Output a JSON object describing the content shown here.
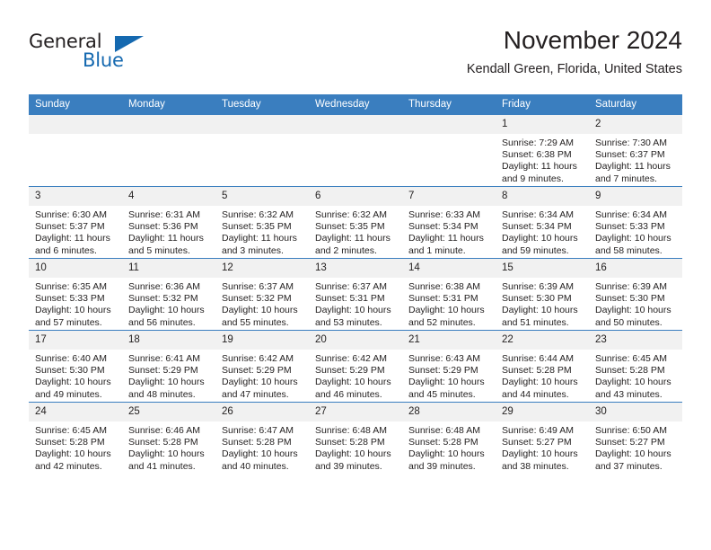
{
  "brand": {
    "name_part1": "General",
    "name_part2": "Blue",
    "accent_color": "#1569b0"
  },
  "header": {
    "title": "November 2024",
    "subtitle": "Kendall Green, Florida, United States"
  },
  "theme": {
    "header_row_bg": "#3a7ebf",
    "daynum_bg": "#f1f1f1",
    "text": "#221f1f"
  },
  "weekdays": [
    "Sunday",
    "Monday",
    "Tuesday",
    "Wednesday",
    "Thursday",
    "Friday",
    "Saturday"
  ],
  "weeks": [
    [
      {
        "day": "",
        "blank": true,
        "sunrise": "",
        "sunset": "",
        "daylight": ""
      },
      {
        "day": "",
        "blank": true,
        "sunrise": "",
        "sunset": "",
        "daylight": ""
      },
      {
        "day": "",
        "blank": true,
        "sunrise": "",
        "sunset": "",
        "daylight": ""
      },
      {
        "day": "",
        "blank": true,
        "sunrise": "",
        "sunset": "",
        "daylight": ""
      },
      {
        "day": "",
        "blank": true,
        "sunrise": "",
        "sunset": "",
        "daylight": ""
      },
      {
        "day": "1",
        "blank": false,
        "sunrise": "Sunrise: 7:29 AM",
        "sunset": "Sunset: 6:38 PM",
        "daylight": "Daylight: 11 hours and 9 minutes."
      },
      {
        "day": "2",
        "blank": false,
        "sunrise": "Sunrise: 7:30 AM",
        "sunset": "Sunset: 6:37 PM",
        "daylight": "Daylight: 11 hours and 7 minutes."
      }
    ],
    [
      {
        "day": "3",
        "blank": false,
        "sunrise": "Sunrise: 6:30 AM",
        "sunset": "Sunset: 5:37 PM",
        "daylight": "Daylight: 11 hours and 6 minutes."
      },
      {
        "day": "4",
        "blank": false,
        "sunrise": "Sunrise: 6:31 AM",
        "sunset": "Sunset: 5:36 PM",
        "daylight": "Daylight: 11 hours and 5 minutes."
      },
      {
        "day": "5",
        "blank": false,
        "sunrise": "Sunrise: 6:32 AM",
        "sunset": "Sunset: 5:35 PM",
        "daylight": "Daylight: 11 hours and 3 minutes."
      },
      {
        "day": "6",
        "blank": false,
        "sunrise": "Sunrise: 6:32 AM",
        "sunset": "Sunset: 5:35 PM",
        "daylight": "Daylight: 11 hours and 2 minutes."
      },
      {
        "day": "7",
        "blank": false,
        "sunrise": "Sunrise: 6:33 AM",
        "sunset": "Sunset: 5:34 PM",
        "daylight": "Daylight: 11 hours and 1 minute."
      },
      {
        "day": "8",
        "blank": false,
        "sunrise": "Sunrise: 6:34 AM",
        "sunset": "Sunset: 5:34 PM",
        "daylight": "Daylight: 10 hours and 59 minutes."
      },
      {
        "day": "9",
        "blank": false,
        "sunrise": "Sunrise: 6:34 AM",
        "sunset": "Sunset: 5:33 PM",
        "daylight": "Daylight: 10 hours and 58 minutes."
      }
    ],
    [
      {
        "day": "10",
        "blank": false,
        "sunrise": "Sunrise: 6:35 AM",
        "sunset": "Sunset: 5:33 PM",
        "daylight": "Daylight: 10 hours and 57 minutes."
      },
      {
        "day": "11",
        "blank": false,
        "sunrise": "Sunrise: 6:36 AM",
        "sunset": "Sunset: 5:32 PM",
        "daylight": "Daylight: 10 hours and 56 minutes."
      },
      {
        "day": "12",
        "blank": false,
        "sunrise": "Sunrise: 6:37 AM",
        "sunset": "Sunset: 5:32 PM",
        "daylight": "Daylight: 10 hours and 55 minutes."
      },
      {
        "day": "13",
        "blank": false,
        "sunrise": "Sunrise: 6:37 AM",
        "sunset": "Sunset: 5:31 PM",
        "daylight": "Daylight: 10 hours and 53 minutes."
      },
      {
        "day": "14",
        "blank": false,
        "sunrise": "Sunrise: 6:38 AM",
        "sunset": "Sunset: 5:31 PM",
        "daylight": "Daylight: 10 hours and 52 minutes."
      },
      {
        "day": "15",
        "blank": false,
        "sunrise": "Sunrise: 6:39 AM",
        "sunset": "Sunset: 5:30 PM",
        "daylight": "Daylight: 10 hours and 51 minutes."
      },
      {
        "day": "16",
        "blank": false,
        "sunrise": "Sunrise: 6:39 AM",
        "sunset": "Sunset: 5:30 PM",
        "daylight": "Daylight: 10 hours and 50 minutes."
      }
    ],
    [
      {
        "day": "17",
        "blank": false,
        "sunrise": "Sunrise: 6:40 AM",
        "sunset": "Sunset: 5:30 PM",
        "daylight": "Daylight: 10 hours and 49 minutes."
      },
      {
        "day": "18",
        "blank": false,
        "sunrise": "Sunrise: 6:41 AM",
        "sunset": "Sunset: 5:29 PM",
        "daylight": "Daylight: 10 hours and 48 minutes."
      },
      {
        "day": "19",
        "blank": false,
        "sunrise": "Sunrise: 6:42 AM",
        "sunset": "Sunset: 5:29 PM",
        "daylight": "Daylight: 10 hours and 47 minutes."
      },
      {
        "day": "20",
        "blank": false,
        "sunrise": "Sunrise: 6:42 AM",
        "sunset": "Sunset: 5:29 PM",
        "daylight": "Daylight: 10 hours and 46 minutes."
      },
      {
        "day": "21",
        "blank": false,
        "sunrise": "Sunrise: 6:43 AM",
        "sunset": "Sunset: 5:29 PM",
        "daylight": "Daylight: 10 hours and 45 minutes."
      },
      {
        "day": "22",
        "blank": false,
        "sunrise": "Sunrise: 6:44 AM",
        "sunset": "Sunset: 5:28 PM",
        "daylight": "Daylight: 10 hours and 44 minutes."
      },
      {
        "day": "23",
        "blank": false,
        "sunrise": "Sunrise: 6:45 AM",
        "sunset": "Sunset: 5:28 PM",
        "daylight": "Daylight: 10 hours and 43 minutes."
      }
    ],
    [
      {
        "day": "24",
        "blank": false,
        "sunrise": "Sunrise: 6:45 AM",
        "sunset": "Sunset: 5:28 PM",
        "daylight": "Daylight: 10 hours and 42 minutes."
      },
      {
        "day": "25",
        "blank": false,
        "sunrise": "Sunrise: 6:46 AM",
        "sunset": "Sunset: 5:28 PM",
        "daylight": "Daylight: 10 hours and 41 minutes."
      },
      {
        "day": "26",
        "blank": false,
        "sunrise": "Sunrise: 6:47 AM",
        "sunset": "Sunset: 5:28 PM",
        "daylight": "Daylight: 10 hours and 40 minutes."
      },
      {
        "day": "27",
        "blank": false,
        "sunrise": "Sunrise: 6:48 AM",
        "sunset": "Sunset: 5:28 PM",
        "daylight": "Daylight: 10 hours and 39 minutes."
      },
      {
        "day": "28",
        "blank": false,
        "sunrise": "Sunrise: 6:48 AM",
        "sunset": "Sunset: 5:28 PM",
        "daylight": "Daylight: 10 hours and 39 minutes."
      },
      {
        "day": "29",
        "blank": false,
        "sunrise": "Sunrise: 6:49 AM",
        "sunset": "Sunset: 5:27 PM",
        "daylight": "Daylight: 10 hours and 38 minutes."
      },
      {
        "day": "30",
        "blank": false,
        "sunrise": "Sunrise: 6:50 AM",
        "sunset": "Sunset: 5:27 PM",
        "daylight": "Daylight: 10 hours and 37 minutes."
      }
    ]
  ]
}
